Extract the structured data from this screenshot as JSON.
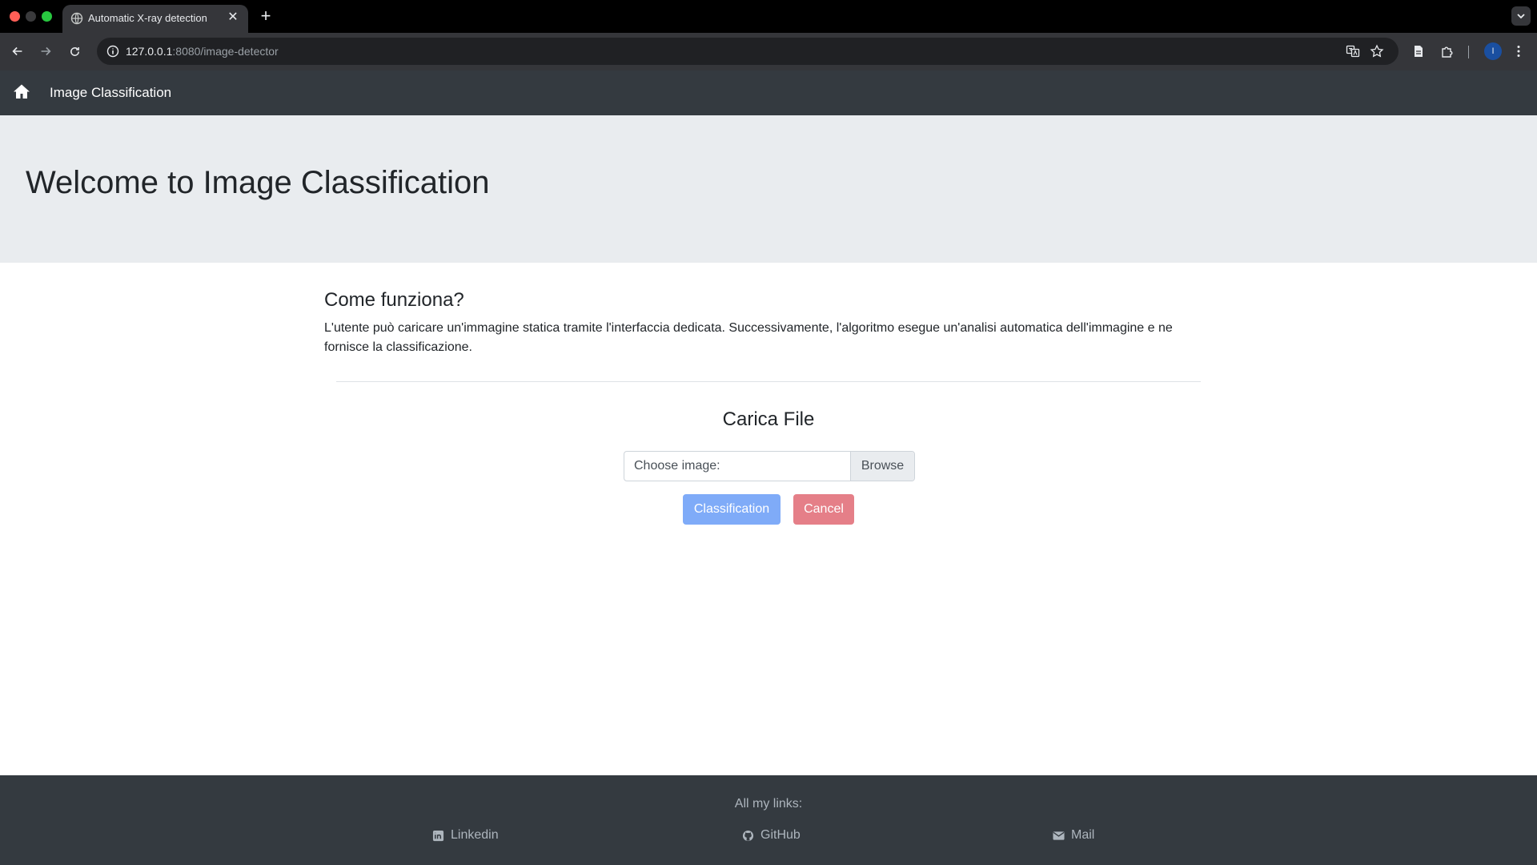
{
  "browser": {
    "tab_title": "Automatic X-ray detection",
    "url_host": "127.0.0.1",
    "url_rest": ":8080/image-detector",
    "profile_initial": "I"
  },
  "navbar": {
    "brand": "Image Classification"
  },
  "jumbotron": {
    "title": "Welcome to Image Classification"
  },
  "how_it_works": {
    "title": "Come funziona?",
    "text": "L'utente può caricare un'immagine statica tramite l'interfaccia dedicata. Successivamente, l'algoritmo esegue un'analisi automatica dell'immagine e ne fornisce la classificazione."
  },
  "upload": {
    "title": "Carica File",
    "file_label": "Choose image:",
    "browse_label": "Browse",
    "classify_label": "Classification",
    "cancel_label": "Cancel"
  },
  "footer": {
    "heading": "All my links:",
    "links": [
      {
        "label": "Linkedin",
        "icon": "linkedin-icon"
      },
      {
        "label": "GitHub",
        "icon": "github-icon"
      },
      {
        "label": "Mail",
        "icon": "mail-icon"
      }
    ]
  },
  "colors": {
    "navbar": "#343a40",
    "jumbotron": "#e9ecef",
    "primary_button": "#7fabf8",
    "danger_button": "#e57f88"
  }
}
